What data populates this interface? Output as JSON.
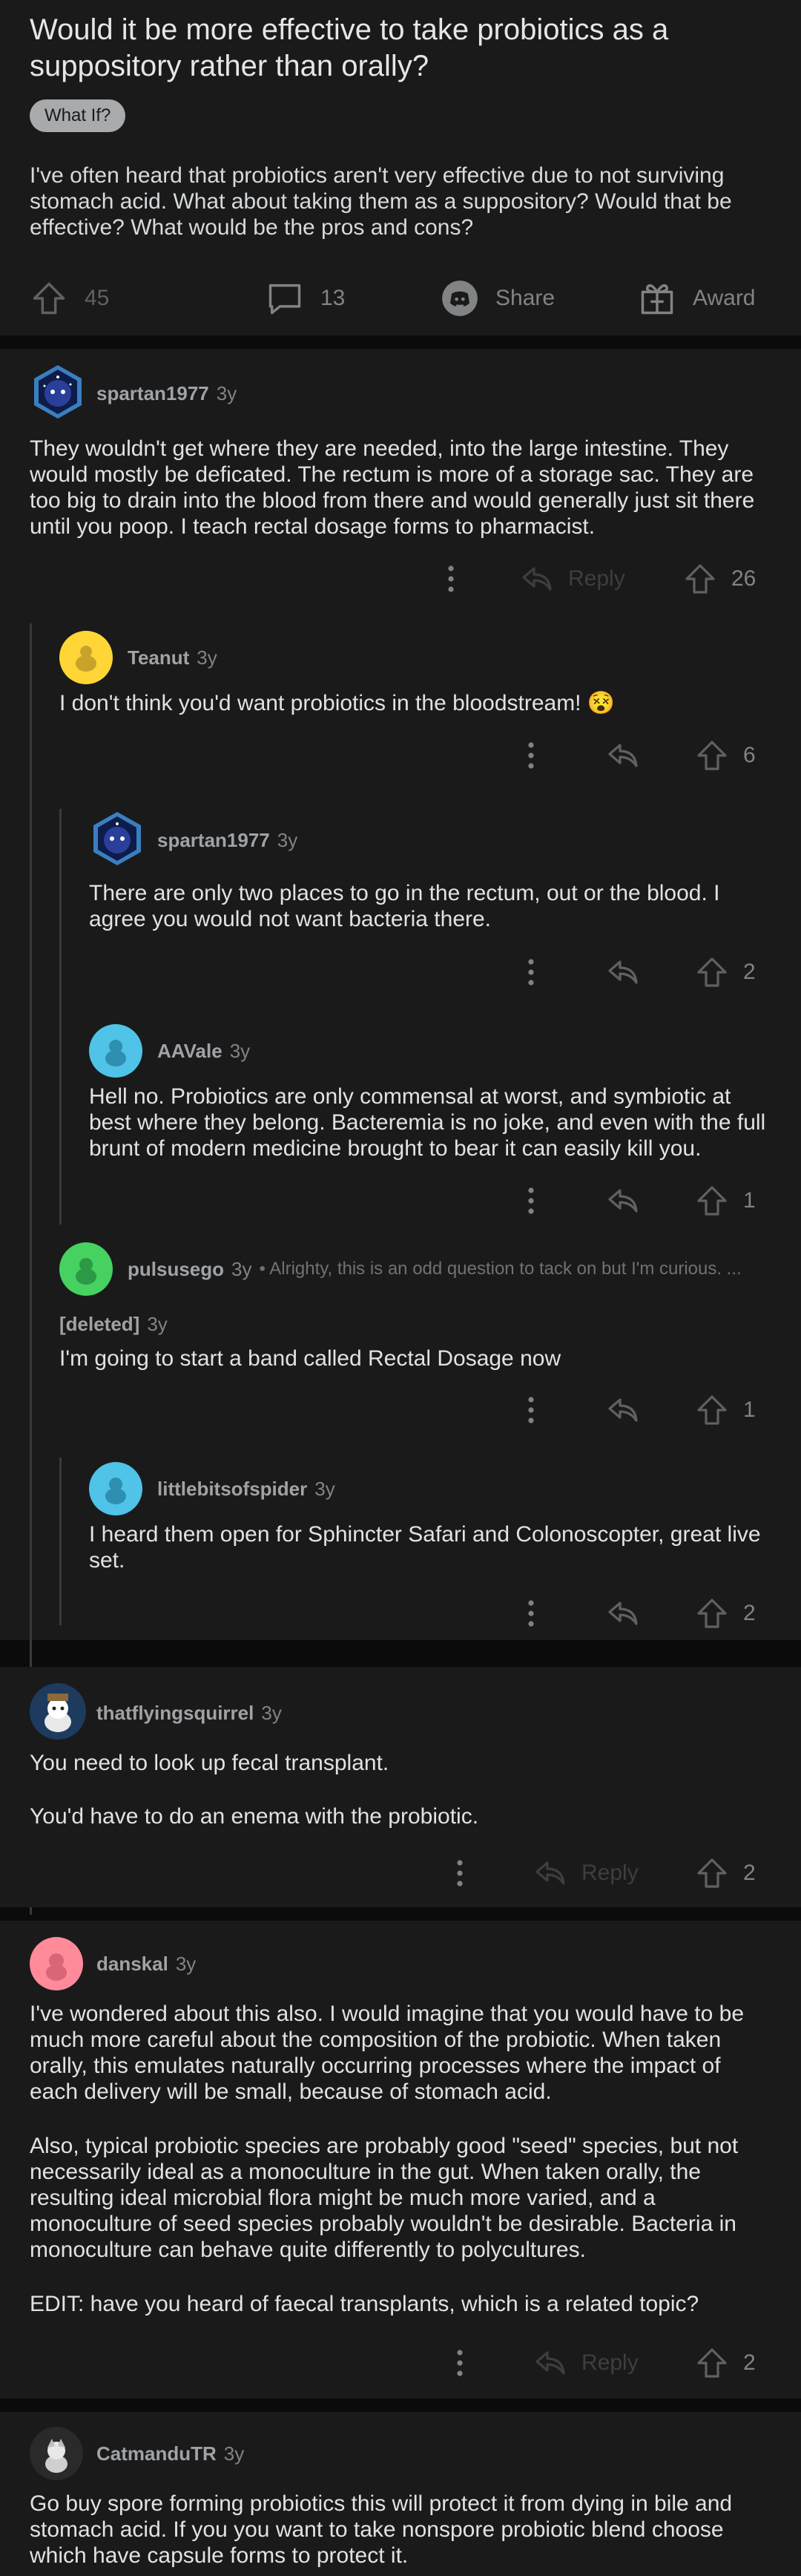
{
  "post": {
    "title": "Would it be more effective to take probiotics as a suppository rather than orally?",
    "flair": "What If?",
    "body": "I've often heard that probiotics aren't very effective due to not surviving stomach acid. What about taking them as a suppository? Would that be effective? What would be the pros and cons?",
    "votes": "45",
    "comments": "13",
    "share_label": "Share",
    "award_label": "Award"
  },
  "comments": {
    "c1": {
      "author": "spartan1977",
      "age": "3y",
      "text": "They wouldn't get where they are needed, into the large intestine. They would mostly be deficated. The rectum is more of a storage sac. They are too big to drain into the blood from there and would generally just sit there until you poop. I teach rectal dosage forms to pharmacist.",
      "reply_label": "Reply",
      "votes": "26"
    },
    "c2": {
      "author": "Teanut",
      "age": "3y",
      "text": "I don't think you'd want probiotics in the bloodstream! 😵",
      "votes": "6"
    },
    "c3": {
      "author": "spartan1977",
      "age": "3y",
      "text": "There are only two places to go in the rectum, out or the blood. I agree you would not want bacteria there.",
      "votes": "2"
    },
    "c4": {
      "author": "AAVale",
      "age": "3y",
      "text": "Hell no. Probiotics are only commensal at worst, and symbiotic at best where they belong. Bacteremia is no joke, and even with the full brunt of modern medicine brought to bear it can easily kill you.",
      "votes": "1"
    },
    "c5": {
      "author": "pulsusego",
      "age": "3y",
      "snippet": "• Alrighty, this is an odd question to tack on but I'm curious. ..."
    },
    "c6": {
      "author": "[deleted]",
      "age": "3y",
      "text": "I'm going to start a band called Rectal Dosage now",
      "votes": "1"
    },
    "c7": {
      "author": "littlebitsofspider",
      "age": "3y",
      "text": "I heard them open for Sphincter Safari and Colonoscopter, great live set.",
      "votes": "2"
    },
    "c8": {
      "author": "thatflyingsquirrel",
      "age": "3y",
      "p1": "You need to look up fecal transplant.",
      "p2": "You'd have to do an enema with the probiotic.",
      "reply_label": "Reply",
      "votes": "2"
    },
    "c9": {
      "author": "danskal",
      "age": "3y",
      "p1": "I've wondered about this also.  I would imagine that you would have to be much more careful about the composition of the probiotic.  When taken orally, this emulates naturally occurring processes where the impact of each delivery will be small, because of stomach acid.",
      "p2": "Also, typical probiotic species are probably good \"seed\" species, but not necessarily ideal as a monoculture in the gut.  When taken orally, the resulting ideal microbial flora might be much more varied, and a monoculture of seed species probably wouldn't be desirable.  Bacteria in monoculture can behave quite differently to polycultures.",
      "p3": "EDIT: have you heard of faecal transplants, which is a related topic?",
      "reply_label": "Reply",
      "votes": "2"
    },
    "c10": {
      "author": "CatmanduTR",
      "age": "3y",
      "text": "Go buy spore forming probiotics this will protect it from dying in bile and stomach acid. If you you want to take nonspore probiotic blend choose which have capsule forms to protect it."
    }
  },
  "icons": {
    "upvote": "upvote-arrow-icon",
    "comment": "comment-bubble-icon",
    "share": "discord-share-icon",
    "award": "award-gift-icon",
    "more": "more-dots-icon",
    "reply": "reply-arrow-icon"
  },
  "colors": {
    "background": "#0b0b0b",
    "panel": "#1a1a1b",
    "text": "#d7dadc",
    "muted": "#818384"
  }
}
